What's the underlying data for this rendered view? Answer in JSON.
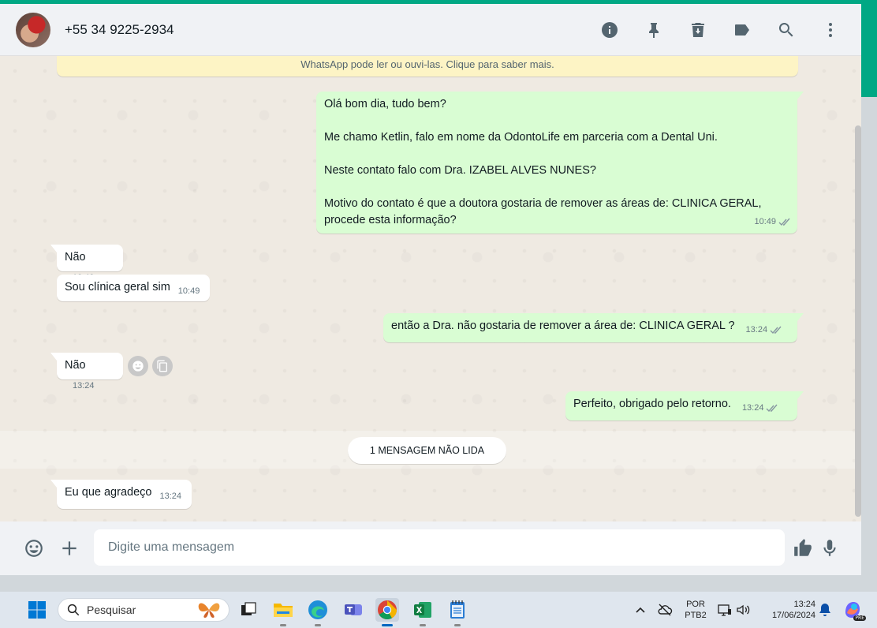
{
  "header": {
    "contact_name": "+55 34 9225-2934",
    "icons": [
      "info-icon",
      "pin-icon",
      "delete-icon",
      "label-icon",
      "search-icon",
      "menu-icon"
    ]
  },
  "chat": {
    "notice": "WhatsApp pode ler ou ouvi-las. Clique para saber mais.",
    "messages": [
      {
        "direction": "out",
        "paragraphs": [
          "Olá bom dia, tudo bem?",
          "Me chamo Ketlin, falo em nome da OdontoLife em parceria com a Dental Uni.",
          "Neste contato falo com Dra. IZABEL ALVES NUNES?",
          "Motivo do contato é que a doutora gostaria de remover as áreas de: CLINICA GERAL, procede esta informação?"
        ],
        "time": "10:49",
        "read": true
      },
      {
        "direction": "in",
        "text": "Não",
        "time": "10:49"
      },
      {
        "direction": "in",
        "text": "Sou clínica geral sim",
        "time": "10:49"
      },
      {
        "direction": "out",
        "text": "então a Dra. não gostaria de remover a área de: CLINICA GERAL ?",
        "time": "13:24",
        "read": true
      },
      {
        "direction": "in",
        "text": "Não",
        "time": "13:24"
      },
      {
        "direction": "out",
        "text": "Perfeito, obrigado pelo retorno.",
        "time": "13:24",
        "read": true
      },
      {
        "direction": "in",
        "text": "Eu que agradeço",
        "time": "13:24"
      }
    ],
    "unread_label": "1 MENSAGEM NÃO LIDA"
  },
  "composer": {
    "placeholder": "Digite uma mensagem"
  },
  "taskbar": {
    "search_placeholder": "Pesquisar",
    "lang_line1": "POR",
    "lang_line2": "PTB2",
    "clock_time": "13:24",
    "clock_date": "17/06/2024",
    "copilot_badge": "PRE"
  },
  "colors": {
    "accent": "#00a884",
    "outgoing": "#d9fdd3",
    "incoming": "#ffffff",
    "read_ticks": "#8696a0"
  }
}
